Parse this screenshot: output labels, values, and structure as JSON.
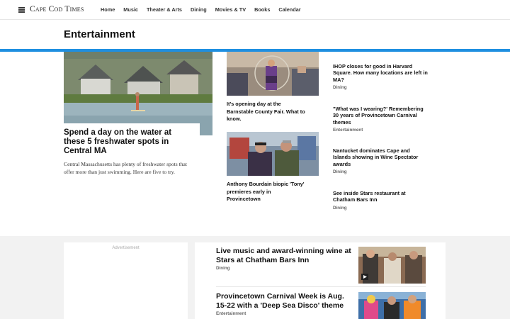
{
  "brand": {
    "logo_text": "Cape Cod Times"
  },
  "nav": {
    "items": [
      {
        "label": "Home"
      },
      {
        "label": "Music"
      },
      {
        "label": "Theater & Arts"
      },
      {
        "label": "Dining"
      },
      {
        "label": "Movies & TV"
      },
      {
        "label": "Books"
      },
      {
        "label": "Calendar"
      }
    ]
  },
  "section": {
    "title": "Entertainment",
    "accent_color": "#1f8fe0"
  },
  "lead": {
    "title": "Spend a day on the water at these 5 freshwater spots in Central MA",
    "description": "Central Massachusetts has plenty of freshwater spots that offer more than just swimming. Here are five to try."
  },
  "middle": [
    {
      "title": "It's opening day at the Barnstable County Fair. What to know."
    },
    {
      "title": "Anthony Bourdain biopic 'Tony' premieres early in Provincetown"
    }
  ],
  "right_list": [
    {
      "title": "IHOP closes for good in Harvard Square. How many locations are left in MA?",
      "category": "Dining"
    },
    {
      "title": "\"What was I wearing?' Remembering 30 years of Provincetown Carnival themes",
      "category": "Entertainment"
    },
    {
      "title": "Nantucket dominates Cape and Islands showing in Wine Spectator awards",
      "category": "Dining"
    },
    {
      "title": "See inside Stars restaurant at Chatham Bars Inn",
      "category": "Dining"
    }
  ],
  "ad": {
    "label": "Advertisement"
  },
  "lower": [
    {
      "title": "Live music and award-winning wine at Stars at Chatham Bars Inn",
      "category": "Dining"
    },
    {
      "title": "Provincetown Carnival Week is Aug. 15-22 with a 'Deep Sea Disco' theme",
      "category": "Entertainment"
    }
  ]
}
